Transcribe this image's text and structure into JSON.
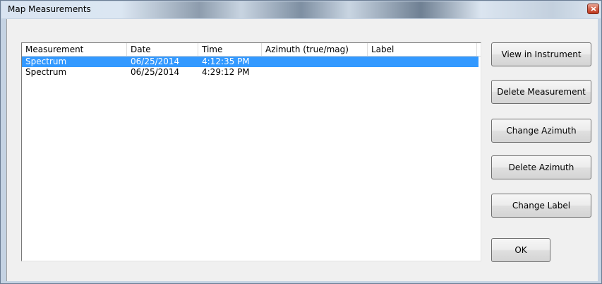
{
  "window": {
    "title": "Map Measurements"
  },
  "list": {
    "columns": [
      "Measurement",
      "Date",
      "Time",
      "Azimuth (true/mag)",
      "Label"
    ],
    "rows": [
      {
        "measurement": "Spectrum",
        "date": "06/25/2014",
        "time": "4:12:35 PM",
        "azimuth": "",
        "label": "",
        "selected": true
      },
      {
        "measurement": "Spectrum",
        "date": "06/25/2014",
        "time": "4:29:12 PM",
        "azimuth": "",
        "label": "",
        "selected": false
      }
    ]
  },
  "buttons": {
    "view_in_instrument": "View in Instrument",
    "delete_measurement": "Delete Measurement",
    "change_azimuth": "Change Azimuth",
    "delete_azimuth": "Delete Azimuth",
    "change_label": "Change Label",
    "ok": "OK"
  },
  "icons": {
    "close": "close-icon"
  },
  "colors": {
    "selection": "#3399ff",
    "close_button": "#c7432a"
  }
}
